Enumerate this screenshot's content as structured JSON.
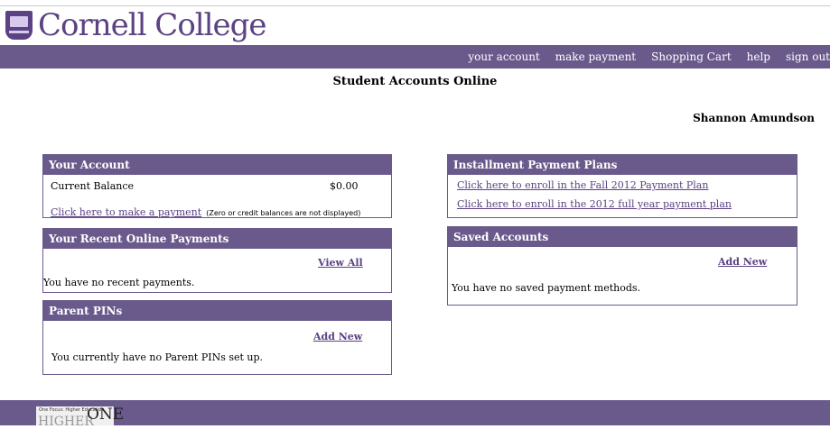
{
  "brand": {
    "name": "Cornell College"
  },
  "nav": {
    "items": [
      "your account",
      "make payment",
      "Shopping Cart",
      "help",
      "sign out"
    ]
  },
  "page": {
    "title": "Student Accounts Online",
    "user_name": "Shannon Amundson"
  },
  "your_account": {
    "title": "Your Account",
    "balance_label": "Current Balance",
    "balance_value": "$0.00",
    "payment_link": "Click here to make a payment",
    "payment_note": "(Zero or credit balances are not displayed)"
  },
  "recent_payments": {
    "title": "Your Recent Online Payments",
    "view_all": "View All",
    "empty": "You have no recent payments."
  },
  "parent_pins": {
    "title": "Parent PINs",
    "add_new": "Add New",
    "empty": "You currently have no Parent PINs set up."
  },
  "installment": {
    "title": "Installment Payment Plans",
    "links": [
      "Click here to enroll in the Fall 2012 Payment Plan",
      "Click here to enroll in the 2012 full year payment plan"
    ]
  },
  "saved_accounts": {
    "title": "Saved Accounts",
    "add_new": "Add New",
    "empty": "You have no saved payment methods."
  },
  "footer": {
    "logo_tag": "One Focus: Higher Education",
    "logo_higher": "HIGHER",
    "logo_one": "ONE"
  },
  "colors": {
    "brand_purple": "#6a5a8c",
    "logo_purple": "#5a4283"
  }
}
